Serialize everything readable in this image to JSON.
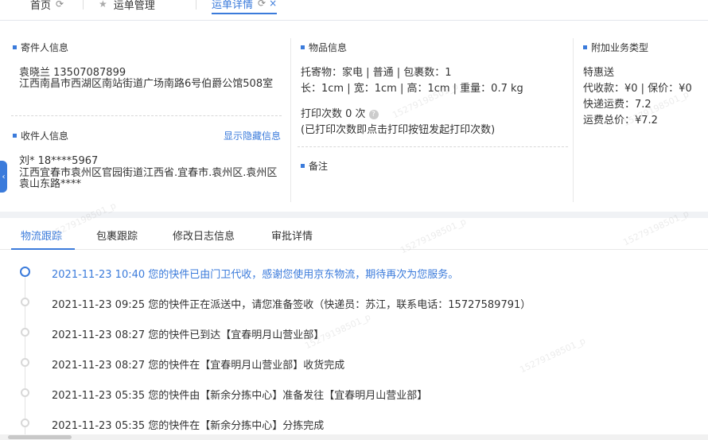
{
  "tabs": [
    {
      "label": "首页"
    },
    {
      "label": "运单管理"
    },
    {
      "label": "运单详情"
    }
  ],
  "sender": {
    "title": "寄件人信息",
    "name_phone": "袁晓兰   13507087899",
    "address": "江西南昌市西湖区南站街道广场南路6号伯爵公馆508室"
  },
  "receiver": {
    "title": "收件人信息",
    "toggle_link": "显示隐藏信息",
    "name_phone": "刘*    18****5967",
    "address": "江西宜春市袁州区官园街道江西省.宜春市.袁州区.袁州区袁山东路****"
  },
  "goods": {
    "title": "物品信息",
    "line1": "托寄物：家电 | 普通 | 包裹数：1",
    "line2": "长：1cm | 宽：1cm | 高：1cm | 重量：0.7 kg",
    "print_count": "打印次数    0 次",
    "print_note": "(已打印次数即点击打印按钮发起打印次数)"
  },
  "remark": {
    "title": "备注"
  },
  "extra": {
    "title": "附加业务类型",
    "service": "特惠送",
    "line1": "代收款：¥0 | 保价：¥0",
    "line2": "快递运费：7.2",
    "line3": "运费总价：¥7.2"
  },
  "track_tabs": [
    {
      "label": "物流跟踪"
    },
    {
      "label": "包裹跟踪"
    },
    {
      "label": "修改日志信息"
    },
    {
      "label": "审批详情"
    }
  ],
  "timeline": [
    {
      "text": "2021-11-23 10:40 您的快件已由门卫代收，感谢您使用京东物流，期待再次为您服务。",
      "active": true
    },
    {
      "text": "2021-11-23 09:25 您的快件正在派送中，请您准备签收（快递员：苏江，联系电话：15727589791）"
    },
    {
      "text": "2021-11-23 08:27 您的快件已到达【宜春明月山营业部】"
    },
    {
      "text": "2021-11-23 08:27 您的快件在【宜春明月山营业部】收货完成"
    },
    {
      "text": "2021-11-23 05:35 您的快件由【新余分拣中心】准备发往【宜春明月山营业部】"
    },
    {
      "text": "2021-11-23 05:35 您的快件在【新余分拣中心】分拣完成"
    }
  ],
  "watermark": "15279198501_p",
  "colors": {
    "accent": "#3b7bdb",
    "band": "#f0f2f5"
  }
}
